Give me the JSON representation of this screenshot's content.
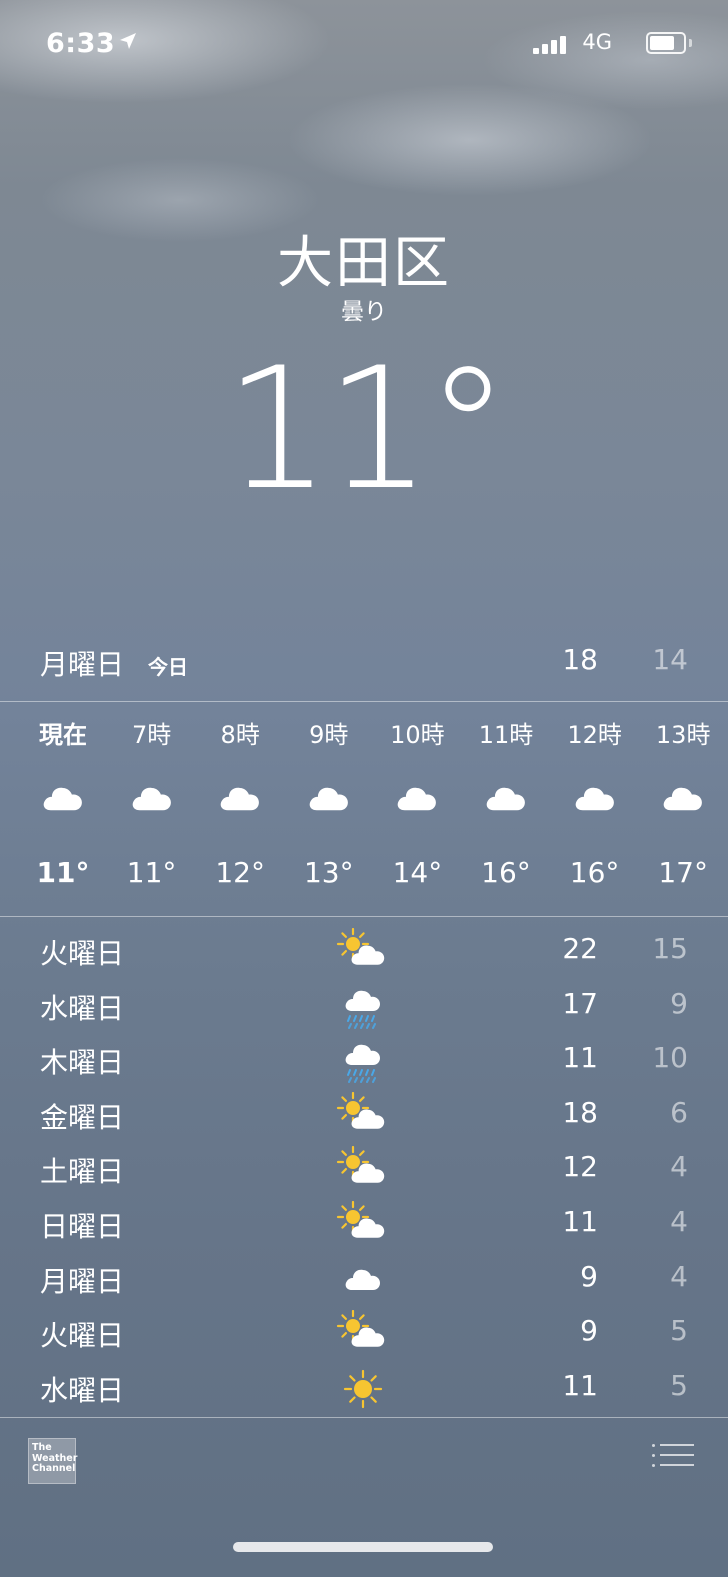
{
  "status_bar": {
    "time": "6:33",
    "network": "4G"
  },
  "location": {
    "city": "大田区",
    "condition": "曇り",
    "temperature": "11°"
  },
  "today": {
    "day": "月曜日",
    "label": "今日",
    "high": "18",
    "low": "14"
  },
  "hourly": [
    {
      "time": "現在",
      "icon": "cloud-icon",
      "temp": "11°"
    },
    {
      "time": "7時",
      "icon": "cloud-icon",
      "temp": "11°"
    },
    {
      "time": "8時",
      "icon": "cloud-icon",
      "temp": "12°"
    },
    {
      "time": "9時",
      "icon": "cloud-icon",
      "temp": "13°"
    },
    {
      "time": "10時",
      "icon": "cloud-icon",
      "temp": "14°"
    },
    {
      "time": "11時",
      "icon": "cloud-icon",
      "temp": "16°"
    },
    {
      "time": "12時",
      "icon": "cloud-icon",
      "temp": "16°"
    },
    {
      "time": "13時",
      "icon": "cloud-icon",
      "temp": "17°"
    }
  ],
  "daily": [
    {
      "day": "火曜日",
      "icon": "partly-cloudy-icon",
      "high": "22",
      "low": "15"
    },
    {
      "day": "水曜日",
      "icon": "rain-icon",
      "high": "17",
      "low": "9"
    },
    {
      "day": "木曜日",
      "icon": "rain-icon",
      "high": "11",
      "low": "10"
    },
    {
      "day": "金曜日",
      "icon": "partly-cloudy-icon",
      "high": "18",
      "low": "6"
    },
    {
      "day": "土曜日",
      "icon": "partly-cloudy-icon",
      "high": "12",
      "low": "4"
    },
    {
      "day": "日曜日",
      "icon": "partly-cloudy-icon",
      "high": "11",
      "low": "4"
    },
    {
      "day": "月曜日",
      "icon": "cloud-icon",
      "high": "9",
      "low": "4"
    },
    {
      "day": "火曜日",
      "icon": "partly-cloudy-icon",
      "high": "9",
      "low": "5"
    },
    {
      "day": "水曜日",
      "icon": "sun-icon",
      "high": "11",
      "low": "5"
    }
  ],
  "footer": {
    "provider_logo": "The Weather Channel"
  },
  "colors": {
    "sun": "#f7c531",
    "rain": "#4aa8e8",
    "low_temp": "#c3c9d1"
  }
}
